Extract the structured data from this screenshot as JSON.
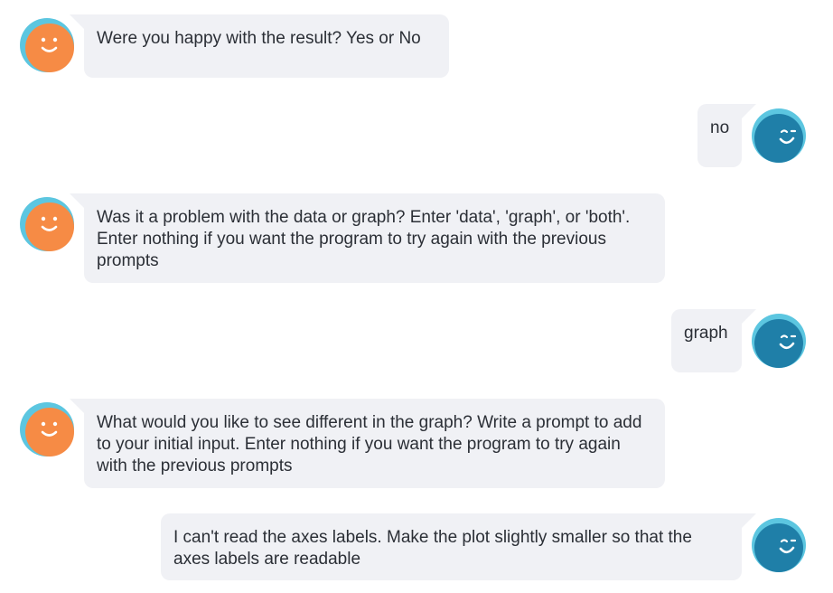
{
  "colors": {
    "bubble_bg": "#f0f1f5",
    "bot_avatar": "#f68b45",
    "bot_avatar_ring": "#5cc6e0",
    "user_avatar": "#1f7fa8",
    "user_avatar_ring": "#5cc6e0",
    "text": "#2b2f36"
  },
  "messages": [
    {
      "sender": "bot",
      "avatar_icon": "smiley-face-icon",
      "text": "Were you happy with the result? Yes or No"
    },
    {
      "sender": "user",
      "avatar_icon": "winking-face-icon",
      "text": "no"
    },
    {
      "sender": "bot",
      "avatar_icon": "smiley-face-icon",
      "text": "Was it a problem with the data or graph? Enter 'data', 'graph', or 'both'. Enter nothing if you want the program to try again with the previous prompts"
    },
    {
      "sender": "user",
      "avatar_icon": "winking-face-icon",
      "text": "graph"
    },
    {
      "sender": "bot",
      "avatar_icon": "smiley-face-icon",
      "text": "What would you like to see different in the graph? Write a prompt to add to your initial input. Enter nothing if you want the program to try again with the previous prompts"
    },
    {
      "sender": "user",
      "avatar_icon": "winking-face-icon",
      "text": "I can't read the axes labels. Make the plot slightly smaller so that the axes labels are readable"
    }
  ]
}
